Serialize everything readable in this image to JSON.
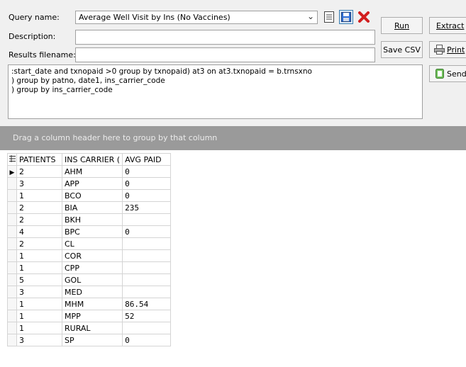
{
  "form": {
    "query_name_label": "Query name:",
    "query_name_value": "Average Well Visit by Ins (No Vaccines)",
    "description_label": "Description:",
    "description_value": "",
    "results_filename_label": "Results filename:",
    "results_filename_value": ""
  },
  "buttons": {
    "run": "Run",
    "extract": "Extract",
    "save_csv": "Save CSV",
    "print": "Print",
    "send": "Send"
  },
  "sql_text": ":start_date and txnopaid >0 group by txnopaid) at3 on at3.txnopaid = b.trnsxno\n) group by patno, date1, ins_carrier_code\n) group by ins_carrier_code",
  "group_panel_text": "Drag a column header here to group by that column",
  "grid": {
    "columns": [
      "PATIENTS",
      "INS CARRIER (",
      "AVG PAID"
    ],
    "rows": [
      [
        "2",
        "AHM",
        "0"
      ],
      [
        "3",
        "APP",
        "0"
      ],
      [
        "1",
        "BCO",
        "0"
      ],
      [
        "2",
        "BIA",
        "235"
      ],
      [
        "2",
        "BKH",
        ""
      ],
      [
        "4",
        "BPC",
        "0"
      ],
      [
        "2",
        "CL",
        ""
      ],
      [
        "1",
        "COR",
        ""
      ],
      [
        "1",
        "CPP",
        ""
      ],
      [
        "5",
        "GOL",
        ""
      ],
      [
        "3",
        "MED",
        ""
      ],
      [
        "1",
        "MHM",
        "86.54"
      ],
      [
        "1",
        "MPP",
        "52"
      ],
      [
        "1",
        "RURAL",
        ""
      ],
      [
        "3",
        "SP",
        "0"
      ]
    ],
    "current_row_index": 0
  },
  "icons": {
    "dropdown": "chevron-down-icon",
    "list": "list-icon",
    "save": "floppy-disk-icon",
    "delete": "red-x-icon",
    "print": "printer-icon",
    "send": "send-icon",
    "row_indicator": "triangle-right-icon"
  },
  "colors": {
    "panel_bg": "#f0f0f0",
    "group_bar_bg": "#9a9a9a",
    "delete_red": "#d21f1f",
    "save_blue": "#2f6fd6"
  }
}
